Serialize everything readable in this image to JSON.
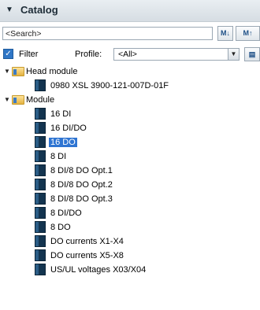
{
  "panel": {
    "title": "Catalog"
  },
  "search": {
    "placeholder": "<Search>",
    "buttons": [
      "search-down-icon",
      "search-up-icon"
    ]
  },
  "filter": {
    "label": "Filter",
    "checked": true,
    "profile_label": "Profile:",
    "profile_value": "<All>"
  },
  "tree": {
    "head_module": {
      "label": "Head module",
      "children": [
        "0980 XSL 3900-121-007D-01F"
      ]
    },
    "module": {
      "label": "Module",
      "selected": "16 DO",
      "children": [
        "16 DI",
        "16 DI/DO",
        "16 DO",
        "8 DI",
        "8 DI/8 DO Opt.1",
        "8 DI/8 DO Opt.2",
        "8 DI/8 DO Opt.3",
        "8 DI/DO",
        "8 DO",
        "DO currents X1-X4",
        "DO currents X5-X8",
        "US/UL voltages X03/X04"
      ]
    }
  }
}
